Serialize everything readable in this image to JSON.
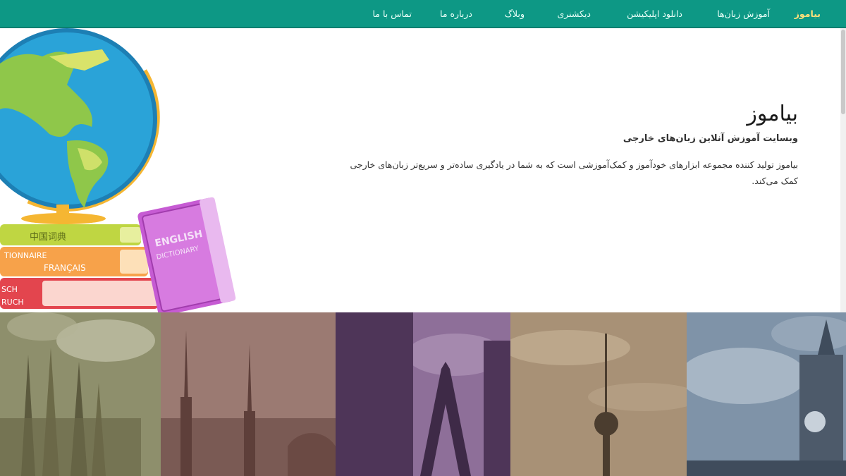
{
  "nav": {
    "brand": "بیاموز",
    "items": [
      "آموزش زبان‌ها",
      "دانلود اپلیکیشن",
      "دیکشنری",
      "وبلاگ",
      "درباره ما",
      "تماس با ما"
    ]
  },
  "hero": {
    "title": "بیاموز",
    "subtitle": "وبسایت آموزش آنلاین زبان‌های خارجی",
    "description": "بیاموز تولید کننده مجموعه ابزارهای خودآموز و کمک‌آموزشی است که به شما در یادگیری ساده‌تر و سریع‌تر زبان‌های خارجی کمک می‌کند."
  },
  "illustration": {
    "book_texts": [
      "中国词典",
      "TIONNAIRE",
      "FRANÇAIS",
      "SCH",
      "RUCH",
      "ENGLISH",
      "DICTIONARY"
    ]
  },
  "gallery": {
    "tiles": [
      {
        "name": "sagrada-familia",
        "tint": "#8a8a66"
      },
      {
        "name": "istanbul-mosque",
        "tint": "#8a6a66"
      },
      {
        "name": "eiffel-tower",
        "tint": "#6e4f78"
      },
      {
        "name": "berlin-tv-tower",
        "tint": "#a48d72"
      },
      {
        "name": "big-ben",
        "tint": "#6f8397"
      }
    ]
  },
  "colors": {
    "nav_bg": "#0d9885",
    "nav_active": "#ffe07a"
  }
}
